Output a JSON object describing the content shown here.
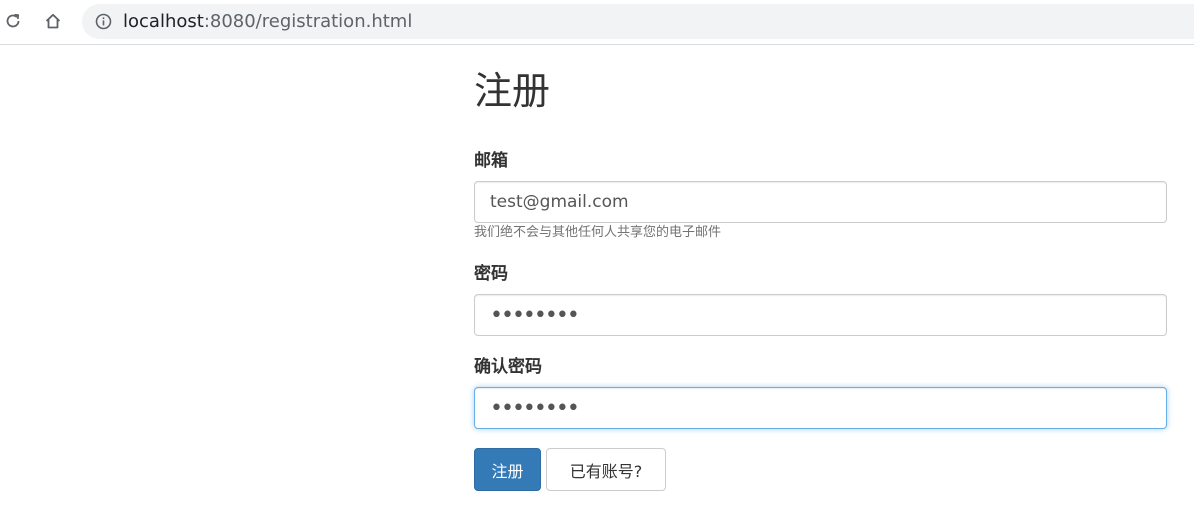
{
  "browser": {
    "url_host": "localhost",
    "url_rest": ":8080/registration.html"
  },
  "form": {
    "title": "注册",
    "email": {
      "label": "邮箱",
      "value": "test@gmail.com",
      "help": "我们绝不会与其他任何人共享您的电子邮件"
    },
    "password": {
      "label": "密码",
      "value": "••••••••"
    },
    "confirm_password": {
      "label": "确认密码",
      "value": "••••••••"
    },
    "submit_label": "注册",
    "login_link_label": "已有账号?"
  },
  "colors": {
    "primary": "#337ab7",
    "focus": "#66afe9"
  }
}
